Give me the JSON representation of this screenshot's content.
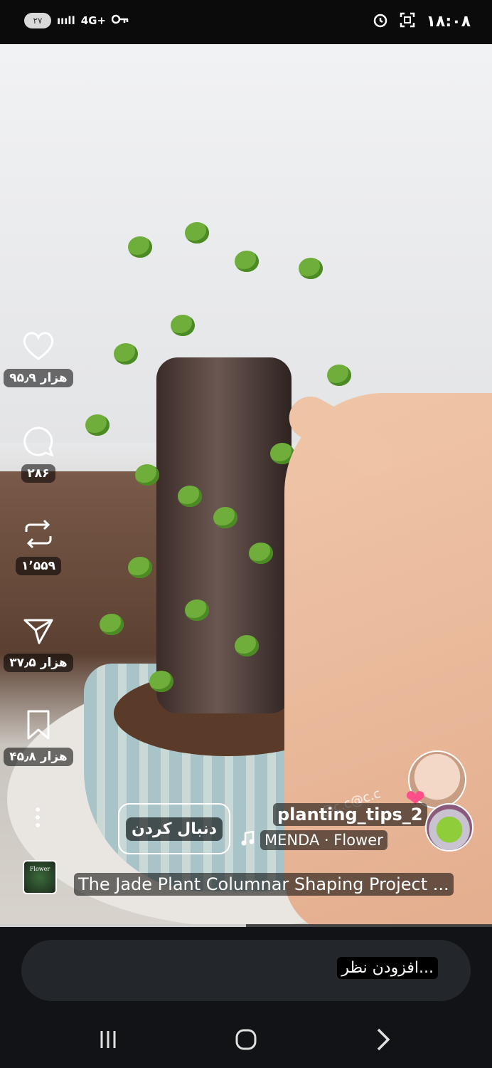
{
  "status_bar": {
    "battery": "۲۷",
    "network": "4G+",
    "time": "۱۸:۰۸"
  },
  "actions": {
    "like_count": "۹۵٫۹ هزار",
    "comment_count": "۲۸۶",
    "repost_count": "۱٬۵۵۹",
    "share_count": "۳۷٫۵ هزار",
    "save_count": "۴۵٫۸ هزار"
  },
  "post": {
    "follow_label": "دنبال کردن",
    "username": "planting_tips_2",
    "music": "MENDA · Flower",
    "caption": "The Jade Plant Columnar Shaping Project ...",
    "watermark": "@c.c@c.c",
    "album_label": "Flower",
    "progress_fraction": 0.5
  },
  "composer": {
    "placeholder": "افزودن نظر..."
  },
  "colors": {
    "background": "#000000",
    "bar": "#111316",
    "input": "#23262b",
    "accent_pink": "#ff4f8b"
  }
}
